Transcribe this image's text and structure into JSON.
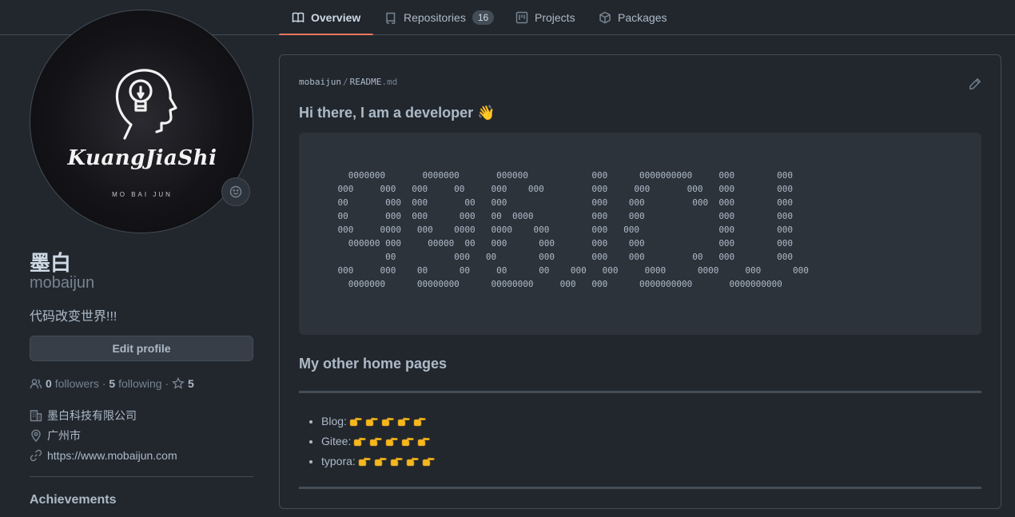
{
  "nav": {
    "tabs": [
      {
        "label": "Overview",
        "icon": "book-icon",
        "active": true
      },
      {
        "label": "Repositories",
        "icon": "repo-icon",
        "count": "16"
      },
      {
        "label": "Projects",
        "icon": "project-icon"
      },
      {
        "label": "Packages",
        "icon": "package-icon"
      }
    ]
  },
  "profile": {
    "avatar_logo_text": "KuangJiaShi",
    "avatar_sub_text": "MO BAI JUN",
    "name": "墨白",
    "login": "mobaijun",
    "bio": "代码改变世界!!!",
    "edit_label": "Edit profile",
    "followers_count": "0",
    "followers_label": "followers",
    "following_count": "5",
    "following_label": "following",
    "stars_count": "5",
    "company": "墨白科技有限公司",
    "location": "广州市",
    "website": "https://www.mobaijun.com",
    "achievements_title": "Achievements"
  },
  "readme": {
    "owner": "mobaijun",
    "separator": "/",
    "file_name": "README",
    "file_ext": ".md",
    "heading": "Hi there, I am a developer 👋",
    "ascii_art": "      0000000       0000000       000000            000      0000000000     000        000\n    000     000   000     00     000    000         000     000       000   000        000\n    00       000  000       00   000                000    000         000  000        000\n    00       000  000      000   00  0000           000    000              000        000\n    000     0000   000    0000   0000    000        000   000               000        000\n      000000 000     00000  00   000      000       000    000              000        000\n             00           000   00        000       000    000         00   000        000\n    000     000    00      00     00      00    000   000     0000      0000     000      000\n      0000000      00000000      00000000     000   000      0000000000       0000000000",
    "section_heading": "My other home pages",
    "links": [
      {
        "label": "Blog:",
        "pointers": 5
      },
      {
        "label": "Gitee:",
        "pointers": 5
      },
      {
        "label": "typora:",
        "pointers": 5
      }
    ]
  },
  "colors": {
    "background": "#22272e",
    "accent_underline": "#ec775c",
    "pointer_emoji": "#f5b81d"
  }
}
